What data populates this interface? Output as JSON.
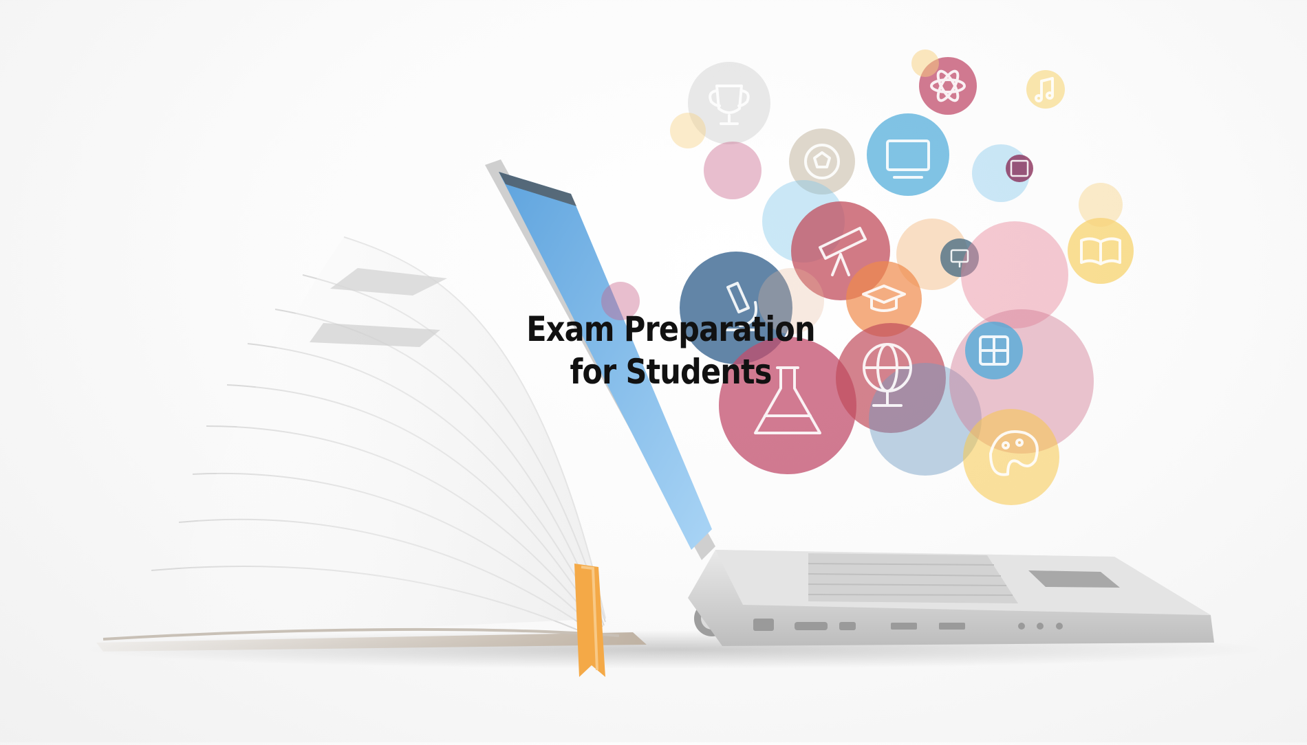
{
  "headline": {
    "line1": "Exam Preparation",
    "line2": "for Students"
  },
  "illustration": {
    "subject": "open-book-laptop",
    "icons": [
      "trophy-icon",
      "soccer-ball-icon",
      "equation-board-icon",
      "atom-icon",
      "music-note-icon",
      "code-window-icon",
      "telescope-icon",
      "monitor-icon",
      "graduation-cap-icon",
      "microscope-icon",
      "open-book-icon",
      "calculator-icon",
      "globe-icon",
      "flask-icon",
      "palette-icon"
    ],
    "colors": {
      "pink": "#c95f86",
      "red": "#b94a5f",
      "blue": "#4aa9d9",
      "navy": "#2e5c8a",
      "orange": "#f08a4b",
      "yellow": "#f7c94c",
      "grey": "#c9c9c9",
      "screen": "#6fb0e6",
      "ribbon": "#f4a947"
    }
  }
}
